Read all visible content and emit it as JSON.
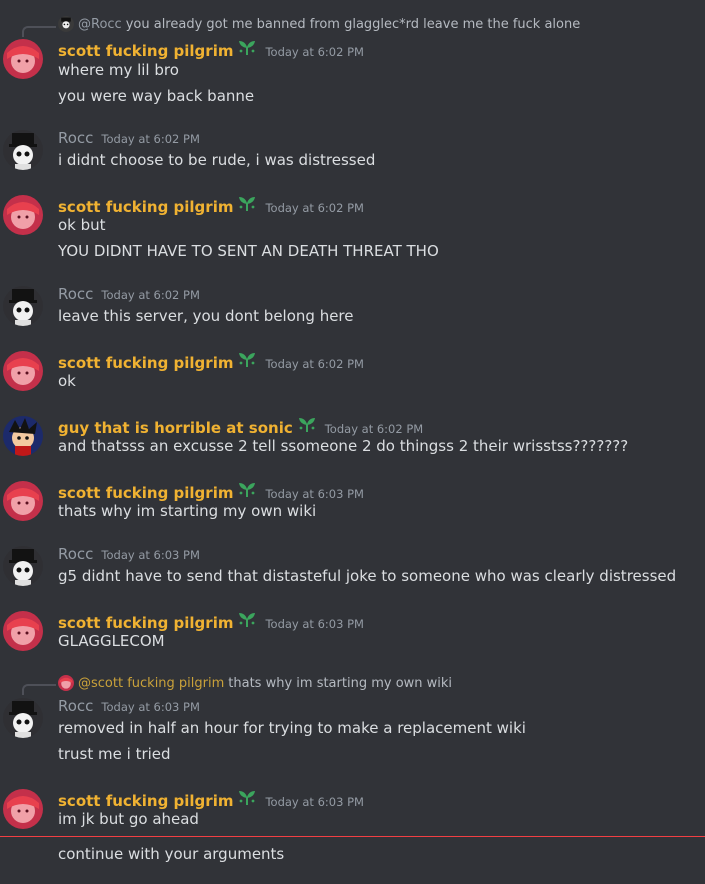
{
  "messages": [
    {
      "reply": {
        "author": "@Rocc",
        "text": "you already got me banned from glagglec*rd leave me the fuck alone"
      },
      "author": "scott fucking pilgrim",
      "timestamp": "Today at 6:02 PM",
      "lines": [
        "where my lil bro",
        "you were way back banne"
      ]
    },
    {
      "author": "Rocc",
      "timestamp": "Today at 6:02 PM",
      "lines": [
        "i didnt choose to be rude, i was distressed"
      ]
    },
    {
      "author": "scott fucking pilgrim",
      "timestamp": "Today at 6:02 PM",
      "lines": [
        "ok but",
        "YOU DIDNT HAVE TO SENT AN DEATH THREAT THO"
      ]
    },
    {
      "author": "Rocc",
      "timestamp": "Today at 6:02 PM",
      "lines": [
        "leave this server, you dont belong here"
      ]
    },
    {
      "author": "scott fucking pilgrim",
      "timestamp": "Today at 6:02 PM",
      "lines": [
        "ok"
      ]
    },
    {
      "author": "guy that is horrible at sonic",
      "timestamp": "Today at 6:02 PM",
      "lines": [
        "and thatsss an excusse 2 tell ssomeone 2 do thingss 2 their wrisstss???????"
      ]
    },
    {
      "author": "scott fucking pilgrim",
      "timestamp": "Today at 6:03 PM",
      "lines": [
        "thats why im starting my own wiki"
      ]
    },
    {
      "author": "Rocc",
      "timestamp": "Today at 6:03 PM",
      "lines": [
        "g5 didnt have to send that distasteful joke to someone who was clearly distressed"
      ]
    },
    {
      "author": "scott fucking pilgrim",
      "timestamp": "Today at 6:03 PM",
      "lines": [
        "GLAGGLECOM"
      ]
    },
    {
      "reply": {
        "author": "@scott fucking pilgrim",
        "text": "thats why im starting my own wiki"
      },
      "author": "Rocc",
      "timestamp": "Today at 6:03 PM",
      "lines": [
        "removed in half an hour for trying to make a replacement wiki",
        "trust me i tried"
      ]
    },
    {
      "author": "scott fucking pilgrim",
      "timestamp": "Today at 6:03 PM",
      "lines": [
        "im jk but go ahead"
      ]
    },
    {
      "lines": [
        "continue with your arguments"
      ]
    }
  ],
  "colors": {
    "background": "#313338",
    "username_role": "#f0b232",
    "username_plain": "#949ba4",
    "new_messages_divider": "#f23f43"
  },
  "icons": {
    "badge": "sprout-badge-icon"
  }
}
